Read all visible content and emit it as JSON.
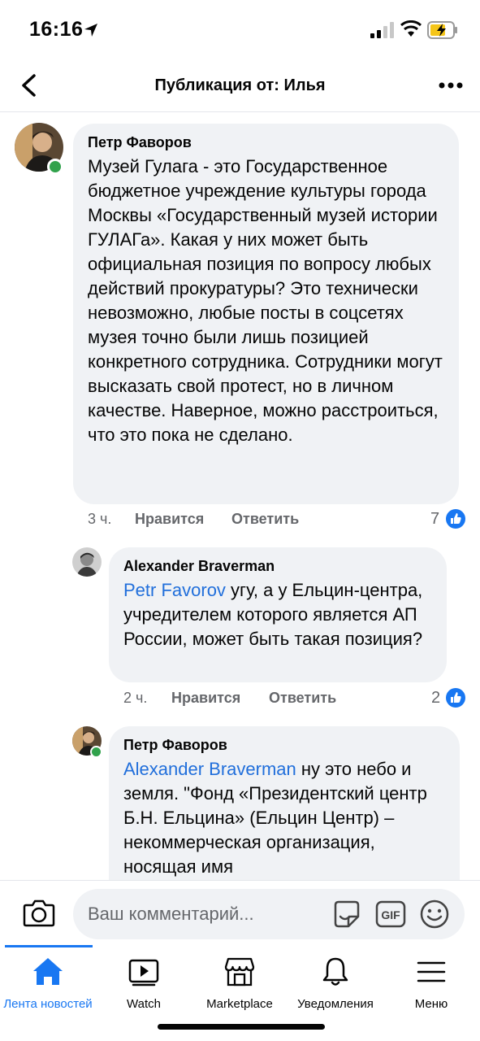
{
  "status_bar": {
    "time": "16:16"
  },
  "header": {
    "title": "Публикация от: Илья"
  },
  "comments": [
    {
      "author": "Петр Фаворов",
      "text": "Музей Гулага - это  Государственное бюджетное учреждение культуры города Москвы «Государственный музей истории ГУЛАГа». Какая у них может быть официальная позиция по вопросу любых действий прокуратуры?  Это технически невозможно, любые посты в соцсетях музея точно были лишь позицией конкретного сотрудника. Сотрудники могут высказать свой протест, но в личном качестве. Наверное, можно расстроиться, что это пока не сделано.",
      "time": "3 ч.",
      "like_label": "Нравится",
      "reply_label": "Ответить",
      "likes": "7"
    },
    {
      "author": "Alexander Braverman",
      "mention": "Petr Favorov",
      "text": " угу, а у Ельцин-центра, учредителем которого является АП России, может быть такая позиция?",
      "time": "2 ч.",
      "like_label": "Нравится",
      "reply_label": "Ответить",
      "likes": "2"
    },
    {
      "author": "Петр Фаворов",
      "mention": "Alexander Braverman",
      "text": " ну это небо и земля. \"Фонд «Президентский центр Б.Н. Ельцина» (Ельцин Центр) – некоммерческая организация, носящая имя"
    }
  ],
  "composer": {
    "placeholder": "Ваш комментарий..."
  },
  "tabs": [
    {
      "label": "Лента новостей",
      "icon": "home-icon",
      "active": true
    },
    {
      "label": "Watch",
      "icon": "watch-icon"
    },
    {
      "label": "Marketplace",
      "icon": "marketplace-icon"
    },
    {
      "label": "Уведомления",
      "icon": "bell-icon"
    },
    {
      "label": "Меню",
      "icon": "menu-icon"
    }
  ],
  "colors": {
    "accent": "#1877f2",
    "mention": "#216fdb",
    "bubble": "#f0f2f5",
    "online": "#31a24c"
  }
}
